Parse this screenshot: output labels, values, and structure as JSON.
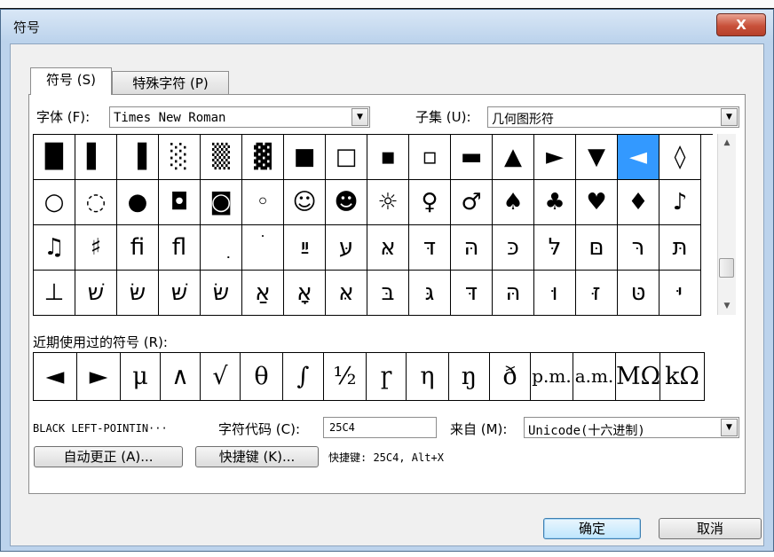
{
  "dialog": {
    "title": "符号",
    "close_glyph": "X"
  },
  "tabs": [
    {
      "label": "符号 (S)",
      "active": true
    },
    {
      "label": "特殊字符 (P)",
      "active": false
    }
  ],
  "font": {
    "label": "字体 (F):",
    "value": "Times New Roman"
  },
  "subset": {
    "label": "子集 (U):",
    "value": "几何图形符"
  },
  "symbol_grid": {
    "rows": [
      [
        "█",
        "▌",
        "▐",
        "░",
        "▒",
        "▓",
        "■",
        "□",
        "▪",
        "▫",
        "▬",
        "▲",
        "►",
        "▼",
        "◄",
        "◊"
      ],
      [
        "○",
        "◌",
        "●",
        "◘",
        "◙",
        "◦",
        "☺",
        "☻",
        "☼",
        "♀",
        "♂",
        "♠",
        "♣",
        "♥",
        "♦",
        "♪"
      ],
      [
        "♫",
        "♯",
        "ﬁ",
        "ﬂ",
        "ִ",
        "ׄ",
        "ײַ",
        "עּ",
        "אּ",
        "דּ",
        "הּ",
        "כּ",
        "לּ",
        "םּ",
        "רּ",
        "תּ"
      ],
      [
        "⊥",
        "שׁ",
        "שּׂ",
        "שּׁ",
        "שּׂ",
        "אַ",
        "אָ",
        "אּ",
        "בּ",
        "גּ",
        "דּ",
        "הּ",
        "וּ",
        "זּ",
        "טּ",
        "יּ"
      ]
    ],
    "selected": "◄"
  },
  "recent": {
    "label": "近期使用过的符号 (R):",
    "symbols": [
      "◄",
      "►",
      "μ",
      "∧",
      "√",
      "θ",
      "∫",
      "½",
      "ɼ",
      "η",
      "ŋ",
      "ð",
      "p.m.",
      "a.m.",
      "MΩ",
      "kΩ"
    ]
  },
  "char_name": "BLACK LEFT-POINTIN···",
  "char_code": {
    "label": "字符代码 (C):",
    "value": "25C4"
  },
  "from": {
    "label": "来自 (M):",
    "value": "Unicode(十六进制)"
  },
  "buttons": {
    "autocorrect": "自动更正 (A)...",
    "shortcut_key": "快捷键 (K)...",
    "ok": "确定",
    "cancel": "取消"
  },
  "shortcut_info": "快捷键: 25C4, Alt+X",
  "colors": {
    "selection": "#3399ff",
    "close_button": "#c8513a",
    "frame": "#bcd3ec"
  }
}
